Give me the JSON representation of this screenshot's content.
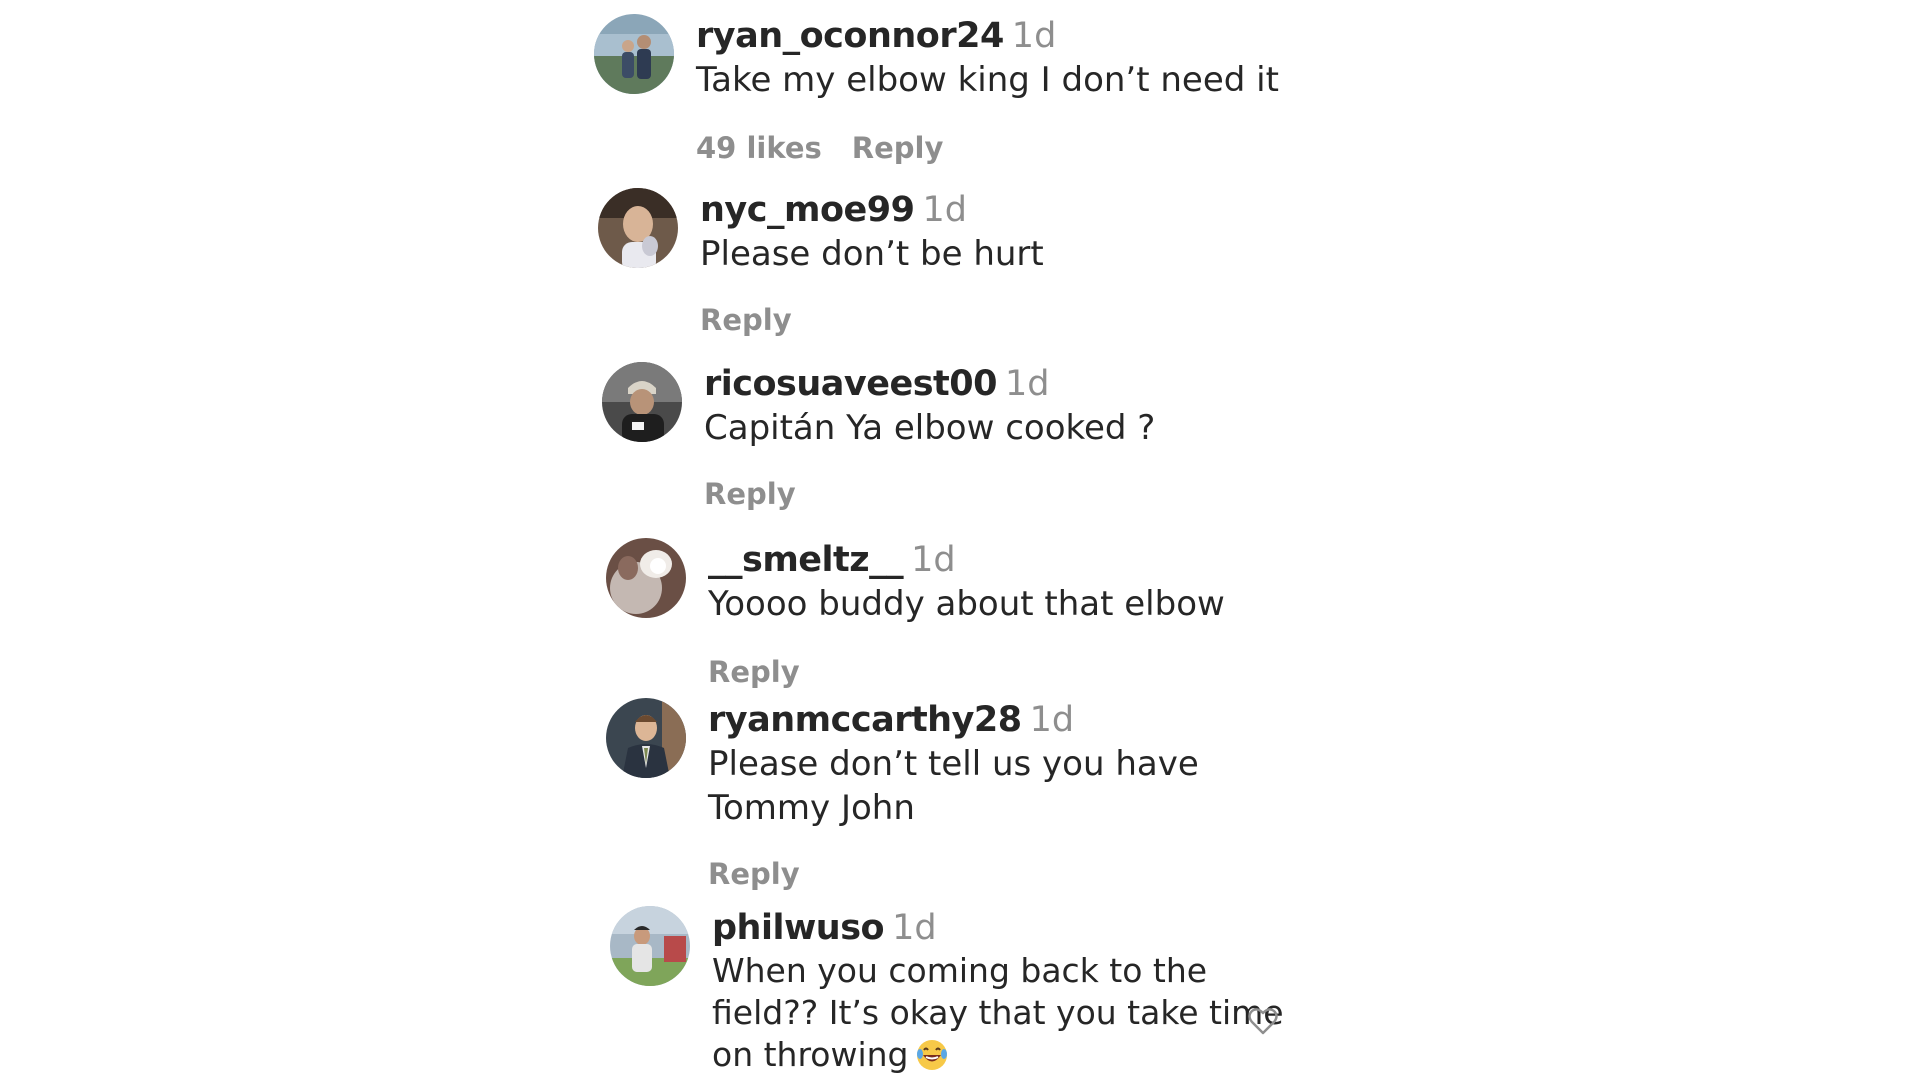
{
  "comments": [
    {
      "username": "ryan_oconnor24",
      "time": "1d",
      "text_lines": [
        "Take my elbow king I don’t need it"
      ],
      "likes": "49 likes",
      "reply": "Reply"
    },
    {
      "username": "nyc_moe99",
      "time": "1d",
      "text_lines": [
        "Please don’t be hurt"
      ],
      "reply": "Reply"
    },
    {
      "username": "ricosuaveest00",
      "time": "1d",
      "text_lines": [
        "Capitán Ya elbow cooked ?"
      ],
      "reply": "Reply"
    },
    {
      "username": "__smeltz__",
      "time": "1d",
      "text_lines": [
        "Yoooo buddy about that elbow"
      ],
      "reply": "Reply"
    },
    {
      "username": "ryanmccarthy28",
      "time": "1d",
      "text_lines": [
        "Please don’t tell us you have",
        "Tommy John"
      ],
      "reply": "Reply"
    },
    {
      "username": "philwuso",
      "time": "1d",
      "text_lines": [
        "When you coming back to the",
        "field?? It’s okay that you take time",
        "on throwing"
      ],
      "emoji": "laughing-crying-emoji"
    }
  ],
  "icons": {
    "like": "heart-outline-icon"
  },
  "colors": {
    "text": "#262626",
    "muted": "#8e8e8e",
    "background": "#ffffff"
  }
}
